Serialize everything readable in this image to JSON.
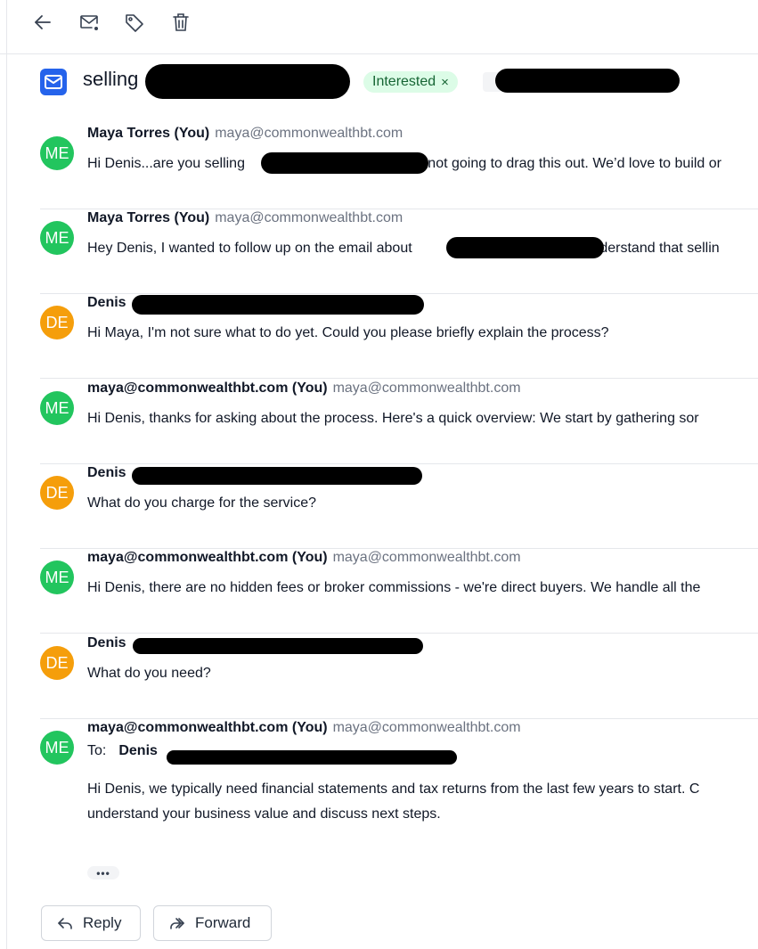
{
  "toolbar": {
    "back_icon": "arrow-left-icon",
    "unread_icon": "mail-dot-icon",
    "label_icon": "tag-icon",
    "delete_icon": "trash-icon"
  },
  "thread": {
    "subject": "selling",
    "tag": "Interested",
    "tag_remove": "×",
    "brand_color": "#2563eb"
  },
  "messages": [
    {
      "initials": "ME",
      "sender": "Maya Torres (You)",
      "email": "maya@commonwealthbt.com",
      "preview_a": "Hi Denis...are you selling",
      "preview_b": "...not going to drag this out. We’d love to build or"
    },
    {
      "initials": "ME",
      "sender": "Maya Torres (You)",
      "email": "maya@commonwealthbt.com",
      "preview_a": "Hey Denis, I wanted to follow up on the email about",
      "preview_b": "I understand that sellin"
    },
    {
      "initials": "DE",
      "sender": "Denis",
      "preview": "Hi Maya, I'm not sure what to do yet. Could you please briefly explain the process?"
    },
    {
      "initials": "ME",
      "sender": "maya@commonwealthbt.com (You)",
      "email": "maya@commonwealthbt.com",
      "preview": "Hi Denis, thanks for asking about the process. Here's a quick overview: We start by gathering sor"
    },
    {
      "initials": "DE",
      "sender": "Denis",
      "preview": "What do you charge for the service?"
    },
    {
      "initials": "ME",
      "sender": "maya@commonwealthbt.com (You)",
      "email": "maya@commonwealthbt.com",
      "preview": "Hi Denis, there are no hidden fees or broker commissions - we're direct buyers. We handle all the"
    },
    {
      "initials": "DE",
      "sender": "Denis",
      "preview": "What do you need?"
    },
    {
      "initials": "ME",
      "sender": "maya@commonwealthbt.com (You)",
      "email": "maya@commonwealthbt.com",
      "to_label": "To:",
      "to_name": "Denis",
      "body_line1": "Hi Denis, we typically need financial statements and tax returns from the last few years to start. C",
      "body_line2": "understand your business value and discuss next steps."
    }
  ],
  "actions": {
    "more": "•••",
    "reply": "Reply",
    "forward": "Forward"
  }
}
